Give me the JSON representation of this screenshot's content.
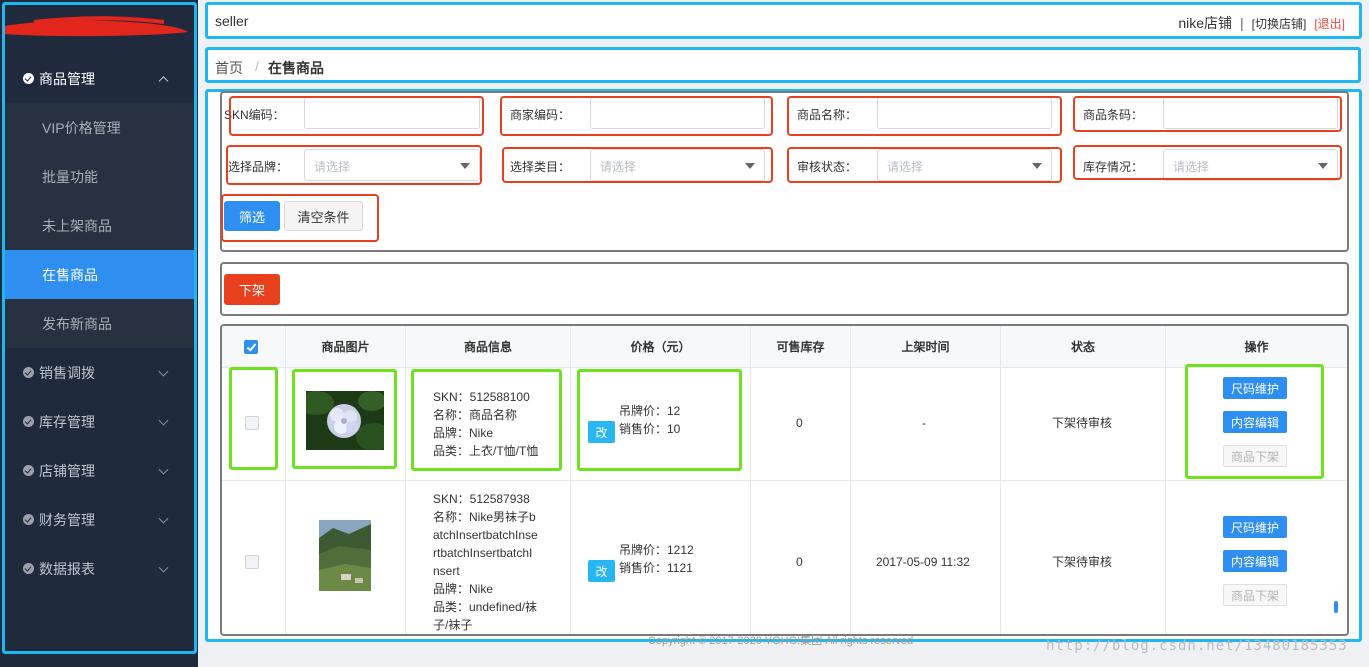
{
  "header": {
    "user": "seller",
    "store": "nike店铺",
    "separator": "|",
    "switch_label": "[切换店铺]",
    "logout_label": "[退出]"
  },
  "breadcrumb": {
    "home": "首页",
    "separator": "/",
    "current": "在售商品"
  },
  "sidebar": {
    "groups": [
      {
        "label": "商品管理",
        "open": true,
        "items": [
          {
            "label": "VIP价格管理"
          },
          {
            "label": "批量功能"
          },
          {
            "label": "未上架商品"
          },
          {
            "label": "在售商品",
            "active": true
          },
          {
            "label": "发布新商品"
          }
        ]
      },
      {
        "label": "销售调拨"
      },
      {
        "label": "库存管理"
      },
      {
        "label": "店铺管理"
      },
      {
        "label": "财务管理"
      },
      {
        "label": "数据报表"
      }
    ]
  },
  "filter": {
    "skn_label": "SKN编码：",
    "merchant_code_label": "商家编码：",
    "name_label": "商品名称：",
    "barcode_label": "商品条码：",
    "brand_label": "选择品牌：",
    "category_label": "选择类目：",
    "audit_label": "审核状态：",
    "stock_label": "库存情况：",
    "select_placeholder": "请选择",
    "filter_button": "筛选",
    "clear_button": "清空条件"
  },
  "actions": {
    "offline_button": "下架"
  },
  "table": {
    "headers": [
      "商品图片",
      "商品信息",
      "价格（元）",
      "可售库存",
      "上架时间",
      "状态",
      "操作"
    ],
    "edit_label": "改",
    "op_buttons": [
      "尺码维护",
      "内容编辑",
      "商品下架"
    ],
    "rows": [
      {
        "info": [
          "SKN：512588100",
          "名称：商品名称",
          "品牌：Nike",
          "品类：上衣/T恤/T恤"
        ],
        "tag_price": "吊牌价：12",
        "sale_price": "销售价：10",
        "stock": "0",
        "time": "-",
        "status": "下架待审核"
      },
      {
        "info": [
          "SKN：512587938",
          "名称：Nike男袜子b",
          "atchInsertbatchInse",
          "rtbatchInsertbatchI",
          "nsert",
          "品牌：Nike",
          "品类：undefined/袜",
          "子/袜子"
        ],
        "tag_price": "吊牌价：1212",
        "sale_price": "销售价：1121",
        "stock": "0",
        "time": "2017-05-09 11:32",
        "status": "下架待审核"
      }
    ]
  },
  "footer": "Copyright © 2017-2020 YOHO!集团 All rights reserved",
  "watermark": "http://blog.csdn.net/13480185353",
  "colors": {
    "sidebar_bg": "#1f2a3c",
    "active": "#2e8ff0",
    "danger": "#e8401c",
    "annotation_blue": "#1fb6f2",
    "annotation_red": "#e8401c",
    "annotation_green": "#6ee21f"
  }
}
